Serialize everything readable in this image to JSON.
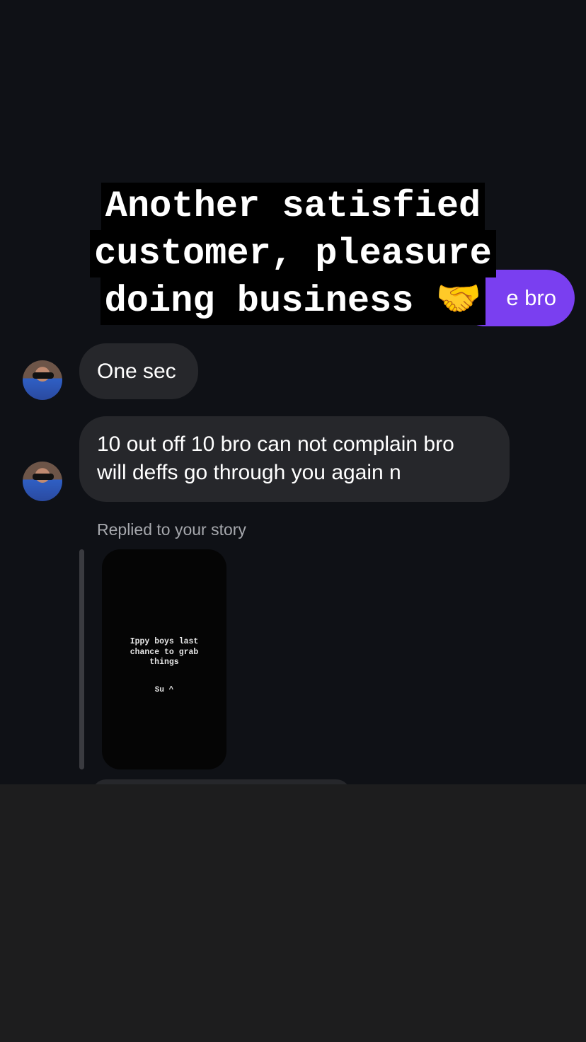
{
  "overlay": {
    "lines": [
      "Another satisfied",
      "customer, pleasure",
      "doing business 🤝"
    ]
  },
  "messages": {
    "outgoing_partial": "e bro",
    "incoming": [
      {
        "text": "One sec"
      },
      {
        "text_line1": "10 out off 10 bro can not complain bro",
        "text_line2": "will deffs go through you again n"
      }
    ]
  },
  "story_reply": {
    "label": "Replied to your story",
    "story_caption_lines": [
      "Ippy boys last",
      "chance to grab",
      "things"
    ],
    "story_sub": "Su ^"
  },
  "colors": {
    "background": "#0f1116",
    "incoming_bubble": "#26272b",
    "outgoing_bubble": "#7a3ff0",
    "bottom_panel": "#1d1d1e"
  }
}
